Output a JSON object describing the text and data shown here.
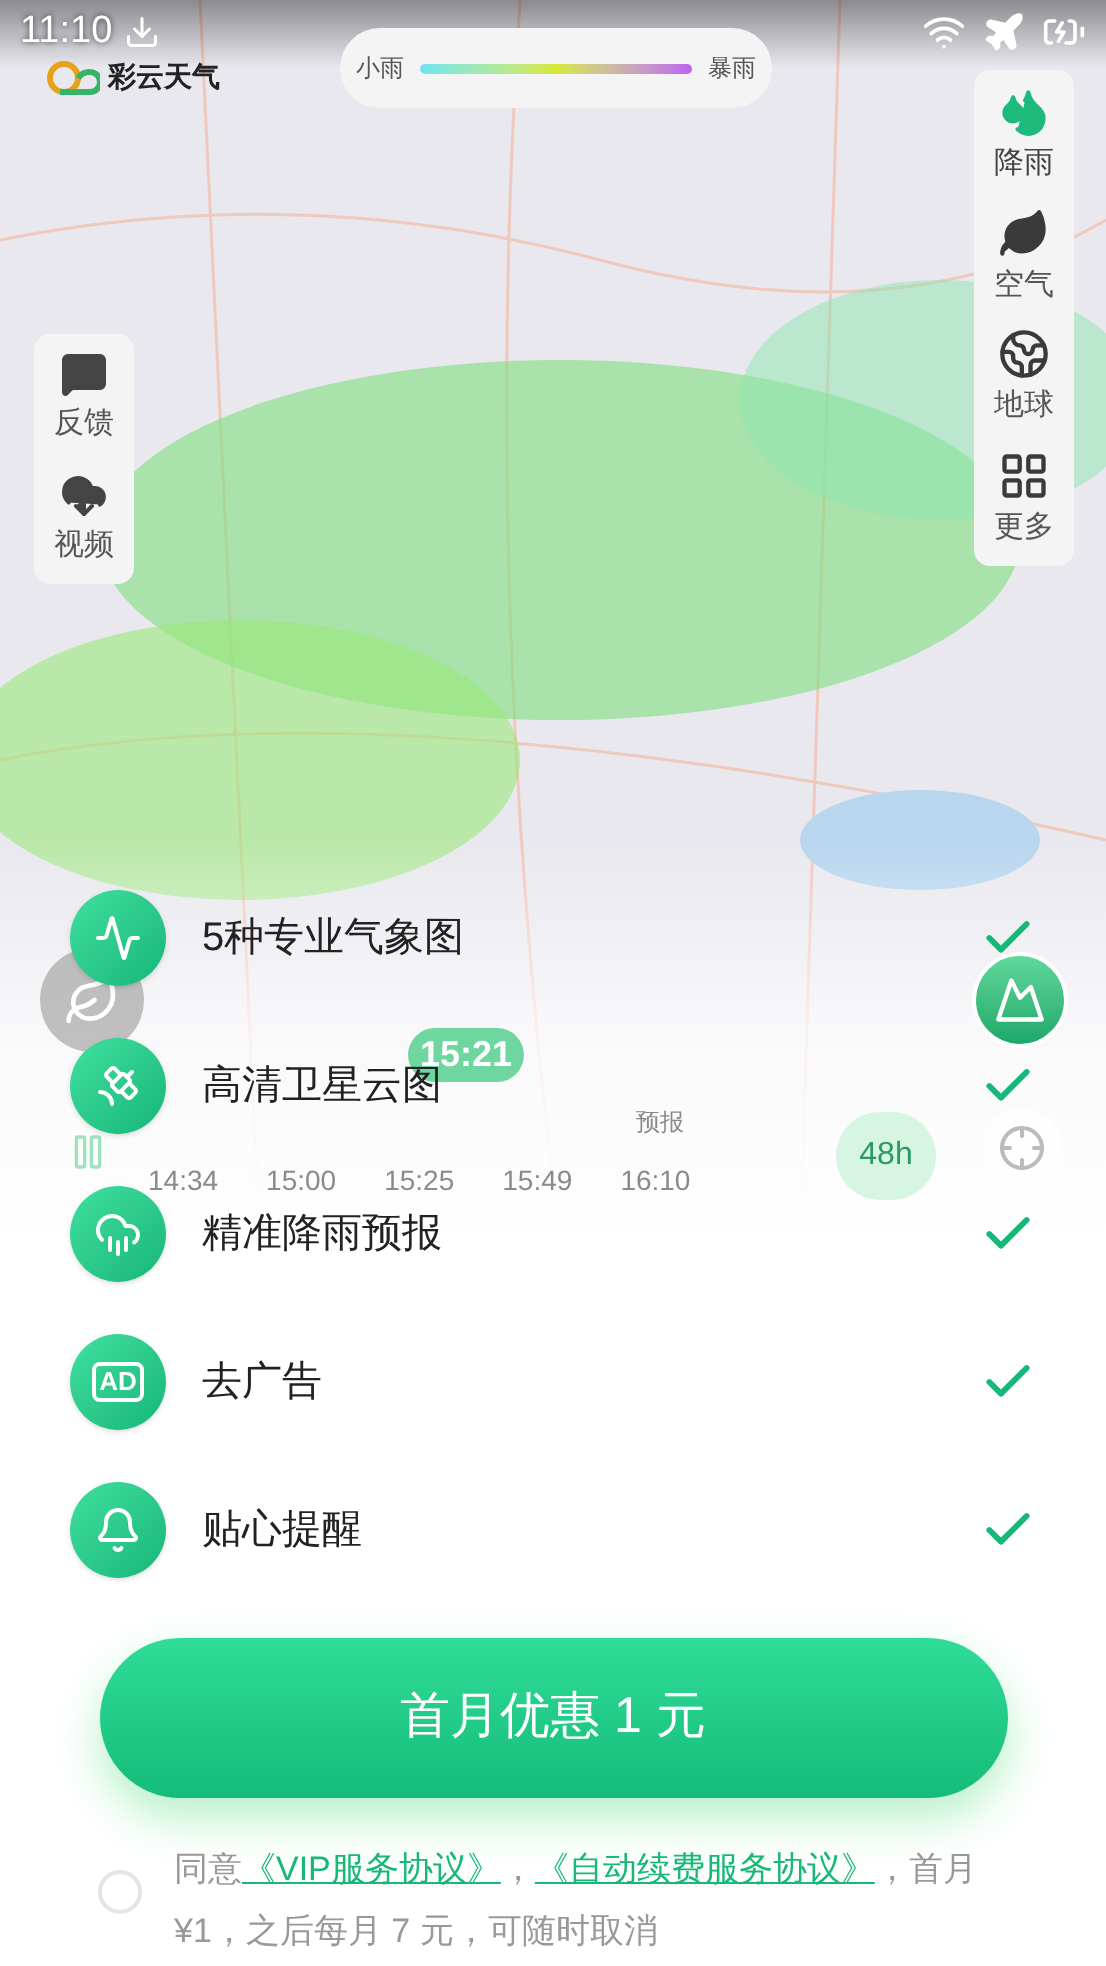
{
  "status_bar": {
    "time": "11:10"
  },
  "app_logo": {
    "name": "彩云天气"
  },
  "legend": {
    "low": "小雨",
    "high": "暴雨"
  },
  "map_tools": [
    {
      "label": "降雨",
      "kind": "rain",
      "selected": true
    },
    {
      "label": "空气",
      "kind": "air",
      "selected": false
    },
    {
      "label": "地球",
      "kind": "globe",
      "selected": false
    },
    {
      "label": "更多",
      "kind": "more",
      "selected": false
    }
  ],
  "side_tools": [
    {
      "label": "反馈",
      "kind": "feedback"
    },
    {
      "label": "视频",
      "kind": "video"
    }
  ],
  "timeline": {
    "current": "15:21",
    "forecast_label": "预报",
    "range": "48h",
    "times": [
      "14:34",
      "15:00",
      "15:25",
      "15:49",
      "16:10"
    ]
  },
  "features": [
    {
      "label": "5种专业气象图",
      "kind": "chart",
      "checked": true
    },
    {
      "label": "高清卫星云图",
      "kind": "satellite",
      "checked": true
    },
    {
      "label": "精准降雨预报",
      "kind": "rain",
      "checked": true
    },
    {
      "label": "去广告",
      "kind": "ad",
      "icon_text": "AD",
      "checked": true
    },
    {
      "label": "贴心提醒",
      "kind": "bell",
      "checked": true
    }
  ],
  "cta": {
    "label": "首月优惠 1 元"
  },
  "agreement": {
    "checked": false,
    "prefix": "同意",
    "link_1": "《VIP服务协议》",
    "separator": "，",
    "link_2": "《自动续费服务协议》",
    "suffix": "，首月 ¥1，之后每月 7 元，可随时取消"
  }
}
